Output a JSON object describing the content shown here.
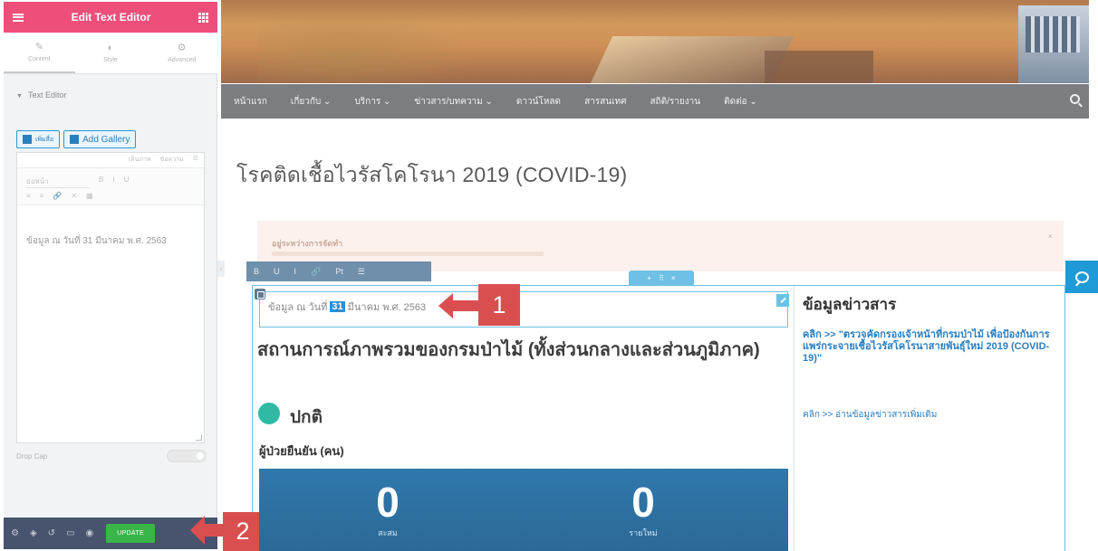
{
  "panel": {
    "title": "Edit Text Editor",
    "tabs": [
      {
        "label": "Content",
        "icon": "pencil-icon"
      },
      {
        "label": "Style",
        "icon": "contrast-icon"
      },
      {
        "label": "Advanced",
        "icon": "gear-icon"
      }
    ],
    "section_title": "Text Editor",
    "add_media_label": "เพิ่มสื่อ",
    "add_gallery_label": "Add Gallery",
    "editor_tabs": [
      "เห็นภาพ",
      "ข้อความ"
    ],
    "format_select": "ย่อหน้า",
    "toolbar_row1": [
      "B",
      "I",
      "U"
    ],
    "toolbar_row2": [
      "≡",
      "≡",
      "🔗",
      "✕",
      "▦"
    ],
    "editor_text": "ข้อมูล ณ วันที่ 31 มีนาคม พ.ศ. 2563",
    "drop_cap_label": "Drop Cap",
    "update_label": "UPDATE",
    "footer_icons": [
      "settings-icon",
      "layers-icon",
      "history-icon",
      "responsive-icon",
      "preview-icon"
    ]
  },
  "nav": {
    "items": [
      "หน้าแรก",
      "เกี่ยวกับ ⌄",
      "บริการ ⌄",
      "ข่าวสาร/บทความ ⌄",
      "ดาวน์โหลด",
      "สารสนเทศ",
      "สถิติ/รายงาน",
      "ติดต่อ ⌄"
    ]
  },
  "page": {
    "title": "โรคติดเชื้อไวรัสโคโรนา 2019 (COVID-19)"
  },
  "notice": {
    "title": "อยู่ระหว่างการจัดทำ",
    "close": "×"
  },
  "section_handle": {
    "add": "+",
    "drag": "⠿",
    "close": "×"
  },
  "inline_toolbar": [
    "B",
    "U",
    "I",
    "🔗",
    "Pt",
    "☰"
  ],
  "widget": {
    "text_before": "ข้อมูล ณ วันที่",
    "text_highlight": "31",
    "text_after": "มีนาคม พ.ศ. 2563"
  },
  "annotations": {
    "badge1": "1",
    "badge2": "2",
    "color": "#d94f50"
  },
  "main": {
    "heading": "สถานการณ์ภาพรวมของกรมป่าไม้ (ทั้งส่วนกลางและส่วนภูมิภาค)",
    "status": "ปกติ",
    "status_color": "#2ebaa5",
    "confirmed_label": "ผู้ป่วยยืนยัน (คน)",
    "stats": [
      {
        "value": "0",
        "caption": "สะสม"
      },
      {
        "value": "0",
        "caption": "รายใหม่"
      }
    ]
  },
  "sidebar_news": {
    "title": "ข้อมูลข่าวสาร",
    "link": "คลิก >> \"ตรวจคัดกรองเจ้าหน้าที่กรมป่าไม้ เพื่อป้องกันการแพร่กระจายเชื้อไวรัสโคโรนาสายพันธุ์ใหม่ 2019 (COVID-19)\"",
    "more": "คลิก >> อ่านข้อมูลข่าวสารเพิ่มเติม"
  },
  "colors": {
    "panel_header": "#ee4f7a",
    "nav_bg": "#7b7d81",
    "accent": "#6ec1e4",
    "update": "#39b54a",
    "stats_bg": "#2f78ab"
  }
}
